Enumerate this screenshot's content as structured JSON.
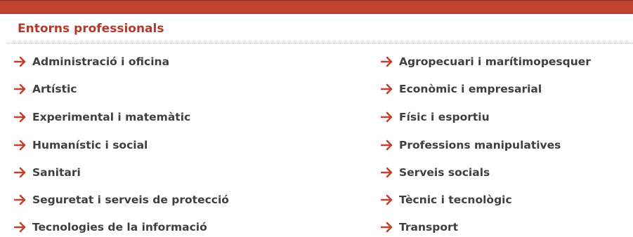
{
  "panel": {
    "title": "Entorns professionals",
    "accent_color": "#c0432f",
    "arrow_icon": "arrow-right-icon"
  },
  "links": {
    "left": [
      {
        "label": "Administració i oficina"
      },
      {
        "label": "Artístic"
      },
      {
        "label": "Experimental i matemàtic"
      },
      {
        "label": "Humanístic i social"
      },
      {
        "label": "Sanitari"
      },
      {
        "label": "Seguretat i serveis de protecció"
      },
      {
        "label": "Tecnologies de la informació"
      }
    ],
    "right": [
      {
        "label": "Agropecuari i marítimopesquer"
      },
      {
        "label": "Econòmic i empresarial"
      },
      {
        "label": "Físic i esportiu"
      },
      {
        "label": "Professions manipulatives"
      },
      {
        "label": "Serveis socials"
      },
      {
        "label": "Tècnic i tecnològic"
      },
      {
        "label": "Transport"
      }
    ]
  }
}
